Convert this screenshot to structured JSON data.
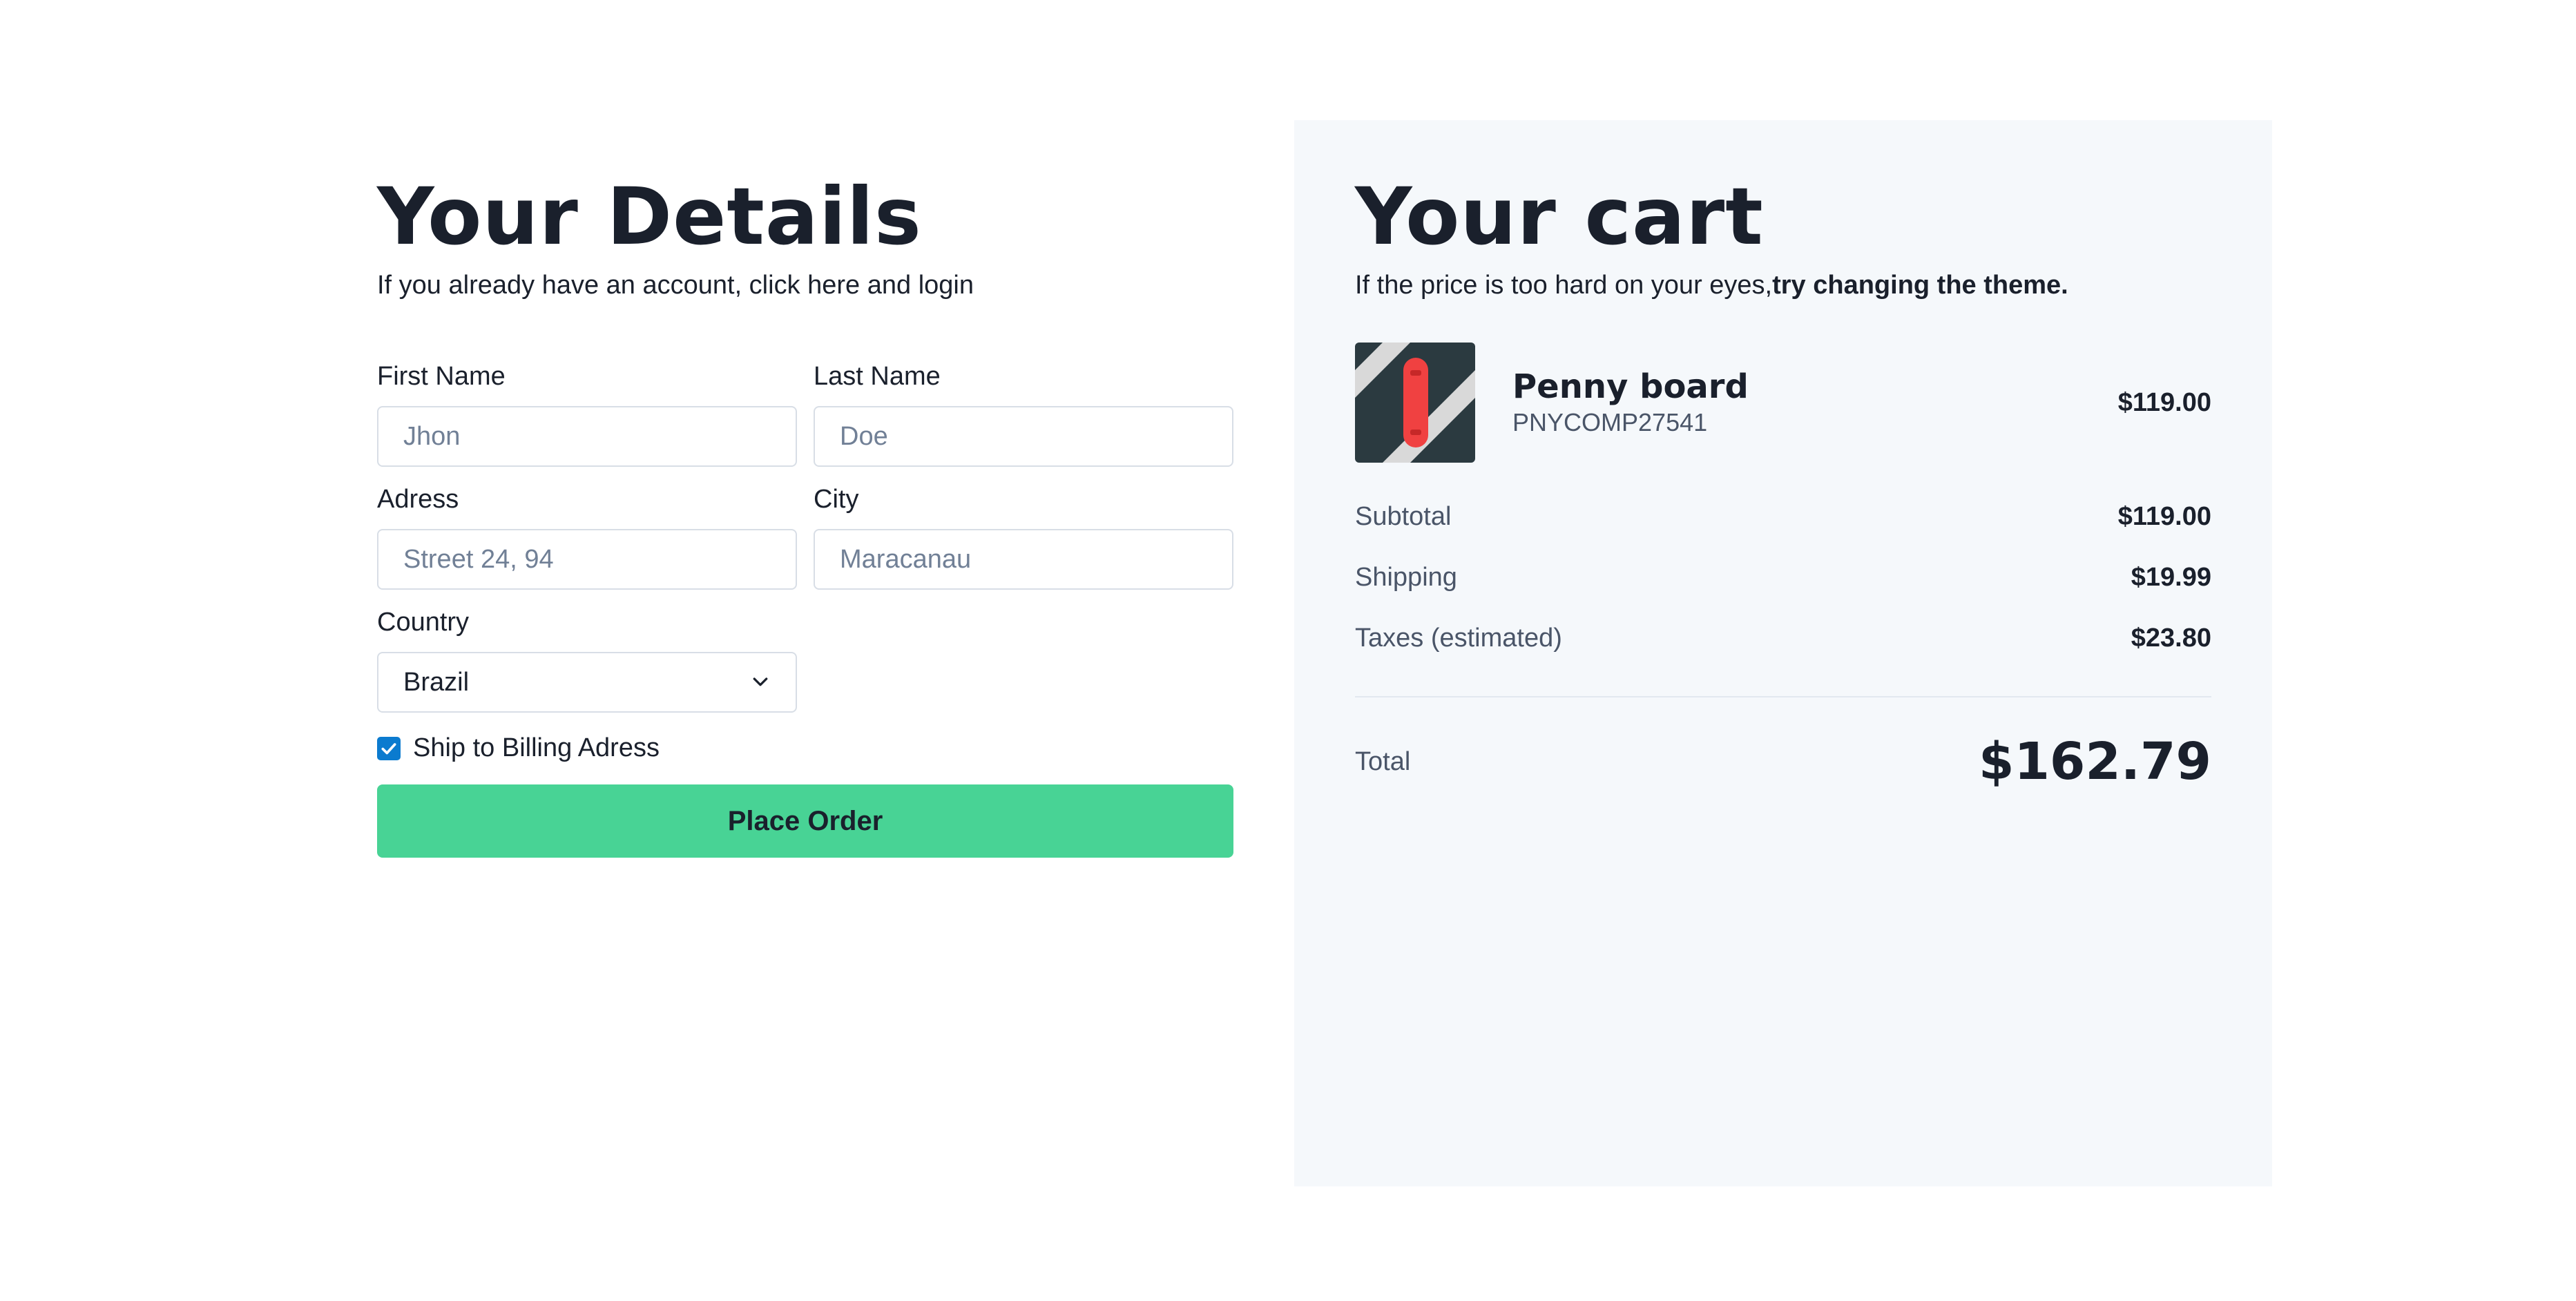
{
  "details": {
    "title": "Your Details",
    "subtitle": "If you already have an account, click here and login",
    "fields": {
      "first_name": {
        "label": "First Name",
        "placeholder": "Jhon"
      },
      "last_name": {
        "label": "Last Name",
        "placeholder": "Doe"
      },
      "address": {
        "label": "Adress",
        "placeholder": "Street 24, 94"
      },
      "city": {
        "label": "City",
        "placeholder": "Maracanau"
      },
      "country": {
        "label": "Country",
        "value": "Brazil"
      }
    },
    "ship_to_billing": {
      "label": "Ship to Billing Adress",
      "checked": true
    },
    "place_order_label": "Place Order"
  },
  "cart": {
    "title": "Your cart",
    "subtitle_prefix": "If the price is too hard on your eyes,",
    "subtitle_link": "try changing the theme.",
    "item": {
      "name": "Penny board",
      "code": "PNYCOMP27541",
      "price": "$119.00"
    },
    "summary": {
      "subtotal_label": "Subtotal",
      "subtotal_value": "$119.00",
      "shipping_label": "Shipping",
      "shipping_value": "$19.99",
      "taxes_label": "Taxes (estimated)",
      "taxes_value": "$23.80"
    },
    "total_label": "Total",
    "total_value": "$162.79"
  },
  "colors": {
    "accent": "#48d395",
    "checkbox": "#0b7bcf",
    "cart_bg": "#f5f8fb",
    "text": "#1a202c"
  },
  "icons": {
    "select": "chevron-down-icon",
    "checkbox": "check-icon",
    "product": "penny-board-image"
  }
}
